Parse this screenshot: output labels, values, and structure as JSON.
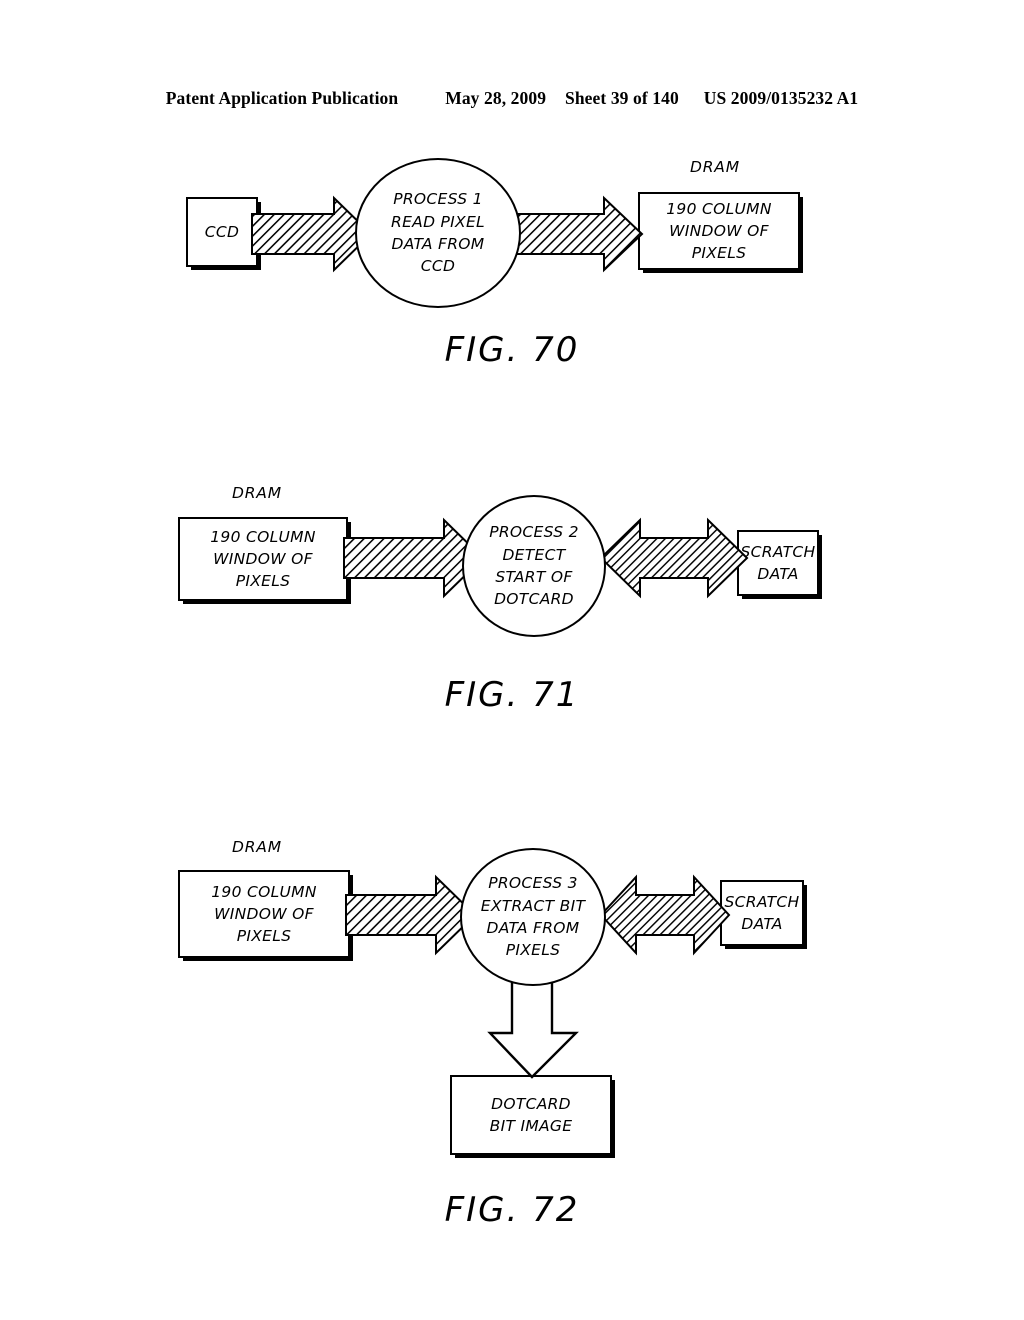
{
  "header": {
    "publication": "Patent Application Publication",
    "date": "May 28, 2009",
    "sheet": "Sheet 39 of 140",
    "patent_number": "US 2009/0135232 A1"
  },
  "figures": [
    {
      "id": "fig-70",
      "title": "FIG. 70",
      "nodes": {
        "source_box": "CCD",
        "process_circle": "PROCESS 1\nREAD PIXEL\nDATA FROM\nCCD",
        "dest_caption": "DRAM",
        "dest_box": "190 COLUMN\nWINDOW OF\nPIXELS"
      },
      "arrows": [
        {
          "name": "ccd-to-process",
          "direction": "right",
          "style": "hatched"
        },
        {
          "name": "process-to-dram",
          "direction": "right",
          "style": "hatched"
        }
      ]
    },
    {
      "id": "fig-71",
      "title": "FIG. 71",
      "nodes": {
        "source_caption": "DRAM",
        "source_box": "190 COLUMN\nWINDOW OF PIXELS",
        "process_circle": "PROCESS 2\nDETECT\nSTART OF\nDOTCARD",
        "dest_box": "SCRATCH\nDATA"
      },
      "arrows": [
        {
          "name": "dram-to-process",
          "direction": "right",
          "style": "hatched"
        },
        {
          "name": "process-scratch-bidirectional",
          "direction": "bidirectional",
          "style": "hatched"
        }
      ]
    },
    {
      "id": "fig-72",
      "title": "FIG. 72",
      "nodes": {
        "source_caption": "DRAM",
        "source_box": "190 COLUMN\nWINDOW OF\nPIXELS",
        "process_circle": "PROCESS 3\nEXTRACT BIT\nDATA FROM\nPIXELS",
        "dest_box": "SCRATCH\nDATA",
        "output_box": "DOTCARD\nBIT IMAGE"
      },
      "arrows": [
        {
          "name": "dram-to-process",
          "direction": "right",
          "style": "hatched"
        },
        {
          "name": "process-scratch-bidirectional",
          "direction": "bidirectional",
          "style": "hatched"
        },
        {
          "name": "process-to-dotcard",
          "direction": "down",
          "style": "outline"
        }
      ]
    }
  ],
  "colors": {
    "ink": "#000000",
    "paper": "#ffffff"
  }
}
